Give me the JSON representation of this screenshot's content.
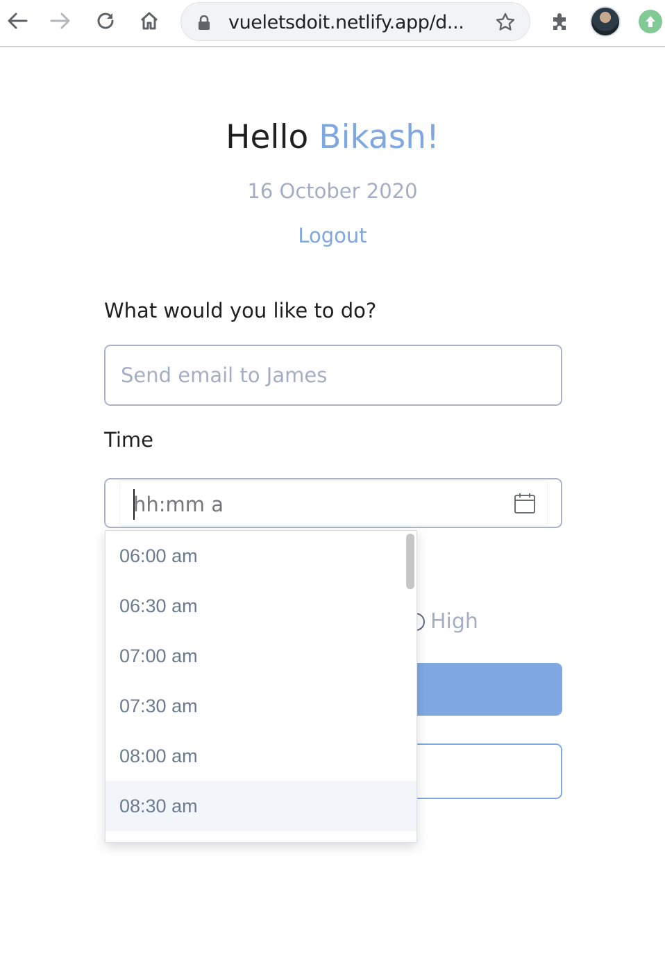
{
  "browser": {
    "url": "vueletsdoit.netlify.app/d...",
    "icons": [
      "back-arrow-icon",
      "forward-arrow-icon",
      "reload-icon",
      "home-icon",
      "lock-icon",
      "star-icon",
      "extensions-puzzle-icon",
      "profile-avatar",
      "update-arrow-icon"
    ]
  },
  "header": {
    "greeting": "Hello ",
    "username": "Bikash!",
    "date": "16 October 2020",
    "logout": "Logout"
  },
  "form": {
    "task_label": "What would you like to do?",
    "task_placeholder": "Send email to James",
    "time_label": "Time",
    "time_placeholder": "hh:mm a",
    "priority_visible_option": "High"
  },
  "time_dropdown": {
    "options": [
      "06:00 am",
      "06:30 am",
      "07:00 am",
      "07:30 am",
      "08:00 am",
      "08:30 am"
    ],
    "highlighted": "08:30 am"
  },
  "colors": {
    "accent": "#7fa7e1",
    "muted_text": "#a3aec5",
    "input_border": "#a9b4c6",
    "button_blue": "#80a8e3",
    "dropdown_hover": "#f2f6fb"
  }
}
